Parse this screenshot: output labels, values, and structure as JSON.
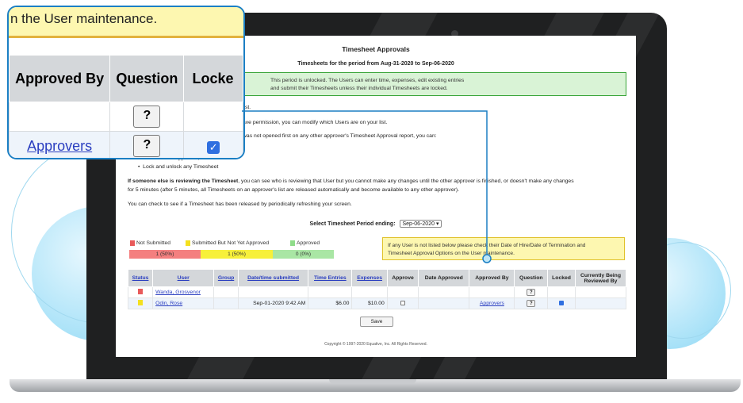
{
  "zoom_callout": {
    "banner_text": "n the User maintenance.",
    "headers": [
      "Approved By",
      "Question",
      "Locke"
    ],
    "rows": [
      {
        "approved_by": "",
        "question": "?",
        "locked": false
      },
      {
        "approved_by": "Approvers",
        "question": "?",
        "locked": true
      }
    ]
  },
  "page": {
    "title": "Timesheet Approvals",
    "period": "Timesheets for the period from Aug-31-2020 to Sep-06-2020",
    "notice_line1": "This period is unlocked. The Users can enter time, expenses, edit existing entries",
    "notice_line2": "and submit their Timesheets unless their individual Timesheets are locked.",
    "info_list_tail": "list.",
    "info_permission": "ave permission, you can modify which Users are on your list.",
    "info_not_opened": "was not opened first on any other approver's Timesheet Approval report, you can:",
    "bullet_leave": "Leave as not-approved, or",
    "bullet_lock": "Lock and unlock any Timesheet",
    "reviewing_bold": "If someone else is reviewing the Timesheet",
    "reviewing_rest": ", you can see who is reviewing that User but you cannot make any changes until the other approver is finished, or doesn't make any changes",
    "reviewing_line2": "for 5 minutes (after 5 minutes, all Timesheets on an approver's list are released automatically and become available to any other approver).",
    "check_release": "You can check to see if a Timesheet has been released by periodically refreshing your screen.",
    "select_label": "Select Timesheet Period ending:",
    "select_value": "Sep-06-2020",
    "legend": [
      {
        "label": "Not Submitted",
        "color": "#e85a5a"
      },
      {
        "label": "Submitted But Not Yet Approved",
        "color": "#f4e01f"
      },
      {
        "label": "Approved",
        "color": "#8fdc8a"
      }
    ],
    "bars": [
      {
        "text": "1 (50%)",
        "color": "#f47f7f"
      },
      {
        "text": "1 (50%)",
        "color": "#f7f03a"
      },
      {
        "text": "0 (0%)",
        "color": "#a9e6a4"
      }
    ],
    "hint_line1": "If any User is not listed below please check their Date of Hire/Date of Termination and",
    "hint_line2": "Timesheet Approval Options on the User maintenance.",
    "table_headers": [
      "Status",
      "User",
      "Group",
      "Date/time submitted",
      "Time Entries",
      "Expenses",
      "Approve",
      "Date Approved",
      "Approved By",
      "Question",
      "Locked",
      "Currently Being Reviewed By"
    ],
    "rows": [
      {
        "status_color": "#e85a5a",
        "user": "Wanda, Grosvenor",
        "group": "",
        "submitted": "",
        "time": "",
        "expenses": "",
        "approve": false,
        "date_approved": "",
        "approved_by": "",
        "question": "?",
        "locked": false,
        "reviewing": ""
      },
      {
        "status_color": "#f4e01f",
        "user": "Odin, Rose",
        "group": "",
        "submitted": "Sep-01-2020 9:42 AM",
        "time": "$6.00",
        "expenses": "$10.00",
        "approve": false,
        "date_approved": "",
        "approved_by": "Approvers",
        "question": "?",
        "locked": true,
        "reviewing": ""
      }
    ],
    "save_label": "Save",
    "copyright": "Copyright © 1997-2020 Equative, Inc. All Rights Reserved."
  }
}
